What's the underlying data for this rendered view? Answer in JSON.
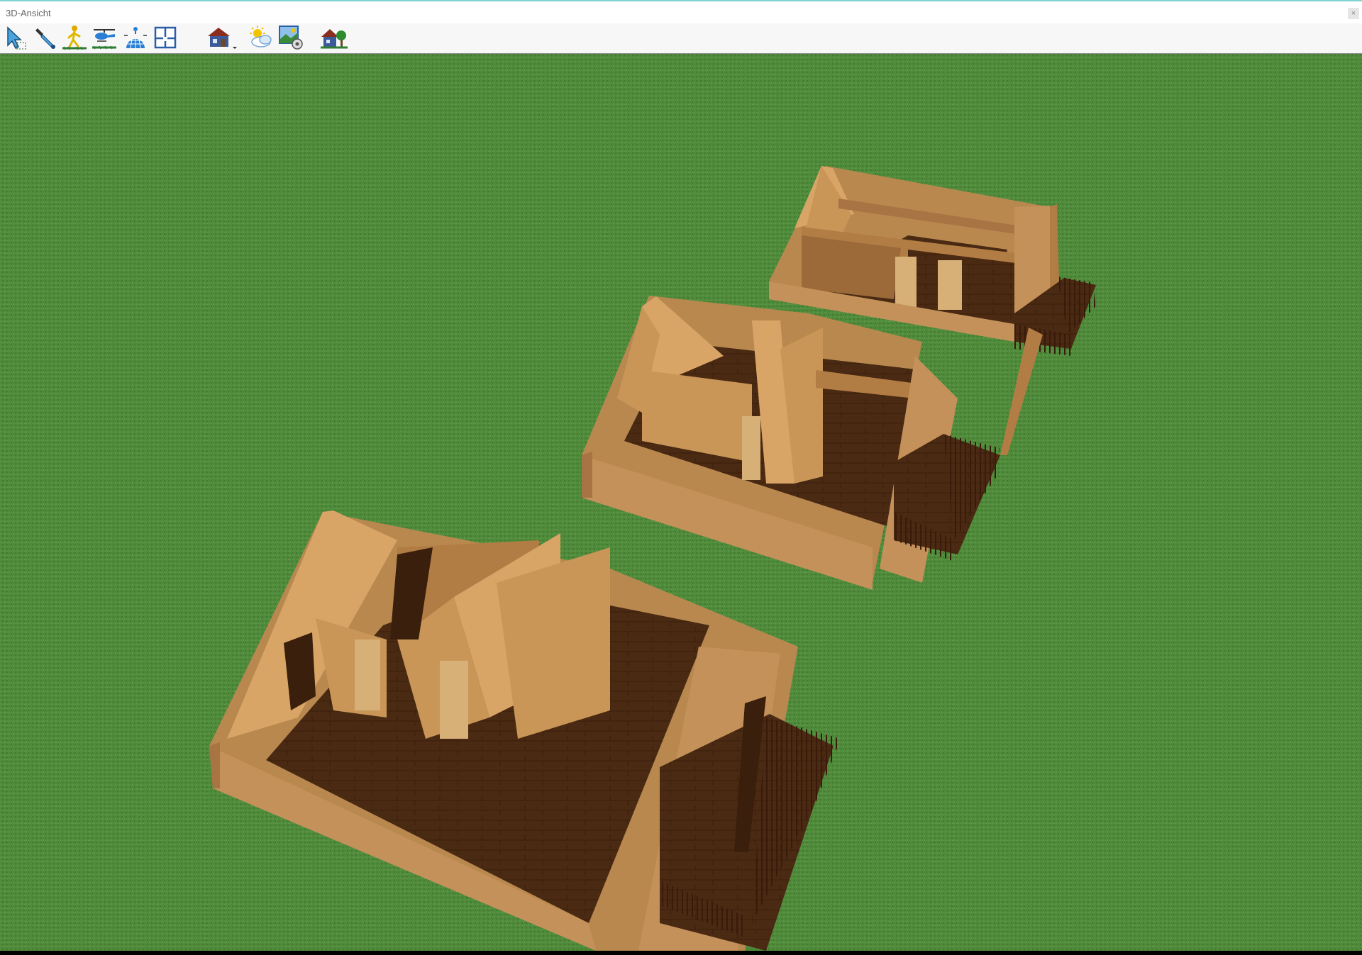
{
  "window": {
    "title": "3D-Ansicht",
    "close_label": "×"
  },
  "toolbar": {
    "tools": [
      {
        "name": "select-tool",
        "icon": "arrow-select-icon"
      },
      {
        "name": "pipette-tool",
        "icon": "pipette-icon"
      },
      {
        "name": "walk-tool",
        "icon": "walking-person-icon"
      },
      {
        "name": "helicopter-tool",
        "icon": "helicopter-icon"
      },
      {
        "name": "orbit-tool",
        "icon": "orbit-sphere-icon"
      },
      {
        "name": "floor-plan-tool",
        "icon": "floor-plan-icon"
      },
      {
        "name": "house-view-tool",
        "icon": "house-dropdown-icon"
      },
      {
        "name": "weather-tool",
        "icon": "sun-cloud-icon"
      },
      {
        "name": "render-settings-tool",
        "icon": "picture-settings-icon"
      },
      {
        "name": "landscape-tool",
        "icon": "house-tree-icon"
      }
    ]
  },
  "scene": {
    "ground_color": "#4f8a3b",
    "wall_color": "#c7955a",
    "floor_color": "#4a2a12",
    "railing_color": "#3a1a0a"
  }
}
